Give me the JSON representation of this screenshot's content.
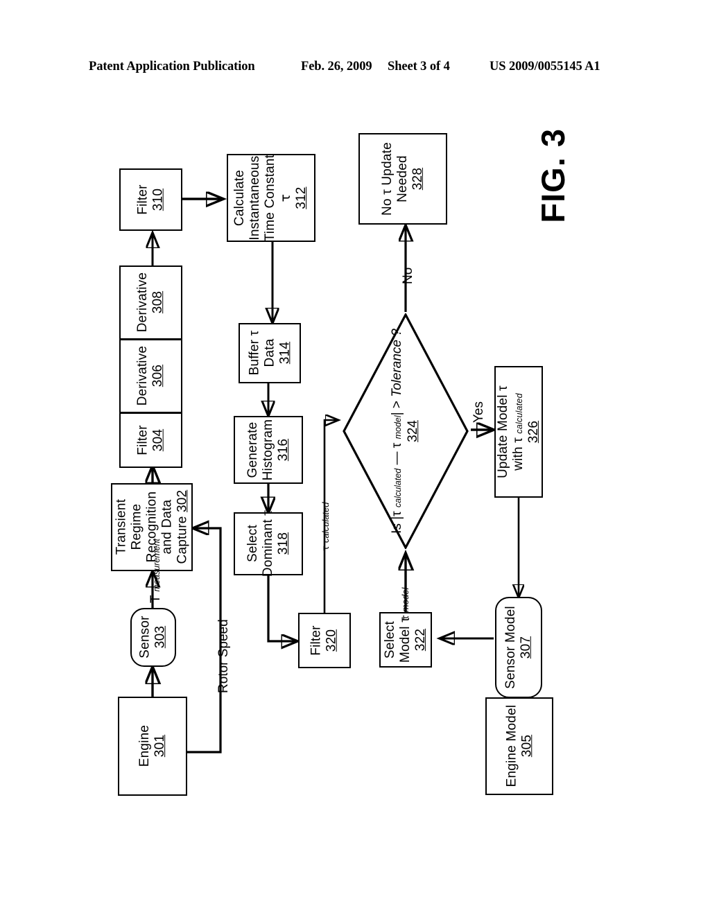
{
  "header": {
    "publication": "Patent Application Publication",
    "date": "Feb. 26, 2009",
    "sheet": "Sheet 3 of 4",
    "patent_number": "US 2009/0055145 A1"
  },
  "figure": {
    "caption": "FIG. 3",
    "nodes": {
      "n301": {
        "line1": "Engine",
        "ref": "301",
        "shape": "rect"
      },
      "n302": {
        "line1": "Transient",
        "line2": "Regime",
        "line3": "Recognition",
        "line4": "and Data",
        "line5": "Capture",
        "ref": "302",
        "shape": "rect"
      },
      "n303": {
        "line1": "Sensor",
        "ref": "303",
        "shape": "rounded"
      },
      "n304": {
        "line1": "Filter",
        "ref": "304",
        "shape": "rect"
      },
      "n305": {
        "line1": "Engine Model",
        "ref": "305",
        "shape": "rect"
      },
      "n306": {
        "line1": "Derivative",
        "ref": "306",
        "shape": "rect"
      },
      "n307": {
        "line1": "Sensor Model",
        "ref": "307",
        "shape": "rounded"
      },
      "n308": {
        "line1": "Derivative",
        "ref": "308",
        "shape": "rect"
      },
      "n310": {
        "line1": "Filter",
        "ref": "310",
        "shape": "rect"
      },
      "n312": {
        "line1": "Calculate",
        "line2": "Instantaneous",
        "line3": "Time Constant",
        "line4": "τ",
        "ref": "312",
        "shape": "rect"
      },
      "n314": {
        "line1": "Buffer τ",
        "line2": "Data",
        "ref": "314",
        "shape": "rect"
      },
      "n316": {
        "line1": "Generate",
        "line2": "Histogram",
        "ref": "316",
        "shape": "rect"
      },
      "n318": {
        "line1": "Select",
        "line2": "Dominant τ",
        "ref": "318",
        "shape": "rect"
      },
      "n320": {
        "line1": "Filter",
        "ref": "320",
        "shape": "rect"
      },
      "n322": {
        "line1": "Select",
        "line2": "Model τ",
        "ref": "322",
        "shape": "rect"
      },
      "n324": {
        "text_pre": "Is |τ ",
        "sub1": "calculated",
        "text_mid": " — τ ",
        "sub2": "model",
        "text_post": "| > ",
        "tolerance": "Tolerance ?",
        "ref": "324",
        "shape": "diamond"
      },
      "n326": {
        "line1": "Update Model τ",
        "line2_pre": "with τ ",
        "line2_sub": "calculated",
        "ref": "326",
        "shape": "rect"
      },
      "n328": {
        "line1": "No τ Update",
        "line2": "Needed",
        "ref": "328",
        "shape": "rect"
      }
    },
    "edge_labels": {
      "t_measurement_pre": "T ",
      "t_measurement_sub": "measurement",
      "rotor_speed": "Rotor Speed",
      "tau_calculated_pre": "τ ",
      "tau_calculated_sub": "calculated",
      "tau_model_pre": "τ ",
      "tau_model_sub": "model",
      "yes": "Yes",
      "no": "No"
    }
  }
}
